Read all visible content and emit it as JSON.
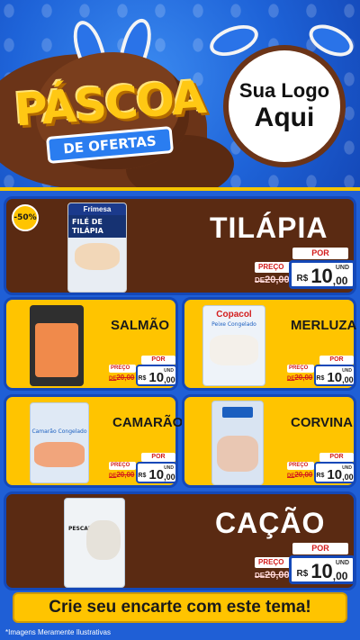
{
  "header": {
    "title": "PÁSCOA",
    "subtitle": "DE OFERTAS",
    "logo_line1": "Sua Logo",
    "logo_line2": "Aqui"
  },
  "badge": "-50%",
  "products": [
    {
      "name": "TILÁPIA",
      "brand": "Frimesa",
      "pack_text": "FILÉ DE TILÁPIA",
      "preco_label": "PREÇO",
      "por_label": "POR",
      "old_prefix": "DE",
      "old_price": "20,00",
      "currency": "R$",
      "new_int": "10",
      "new_dec": ",00",
      "unit": "UND"
    },
    {
      "name": "SALMÃO",
      "brand": "",
      "pack_text": "",
      "preco_label": "PREÇO",
      "por_label": "POR",
      "old_prefix": "DE",
      "old_price": "20,00",
      "currency": "R$",
      "new_int": "10",
      "new_dec": ",00",
      "unit": "UND"
    },
    {
      "name": "MERLUZA",
      "brand": "Copacol",
      "pack_text": "Peixe Congelado",
      "preco_label": "PREÇO",
      "por_label": "POR",
      "old_prefix": "DE",
      "old_price": "20,00",
      "currency": "R$",
      "new_int": "10",
      "new_dec": ",00",
      "unit": "UND"
    },
    {
      "name": "CAMARÃO",
      "brand": "",
      "pack_text": "Camarão Congelado",
      "preco_label": "PREÇO",
      "por_label": "POR",
      "old_prefix": "DE",
      "old_price": "20,00",
      "currency": "R$",
      "new_int": "10",
      "new_dec": ",00",
      "unit": "UND"
    },
    {
      "name": "CORVINA",
      "brand": "",
      "pack_text": "",
      "preco_label": "PREÇO",
      "por_label": "POR",
      "old_prefix": "DE",
      "old_price": "20,00",
      "currency": "R$",
      "new_int": "10",
      "new_dec": ",00",
      "unit": "UND"
    },
    {
      "name": "CAÇÃO",
      "brand": "",
      "pack_text": "PESCADOS",
      "preco_label": "PREÇO",
      "por_label": "POR",
      "old_prefix": "DE",
      "old_price": "20,00",
      "currency": "R$",
      "new_int": "10",
      "new_dec": ",00",
      "unit": "UND"
    }
  ],
  "banner": "Crie seu encarte com este tema!",
  "disclaimer": "*Imagens Meramente Ilustrativas",
  "colors": {
    "background": "#1f5fd6",
    "card_yellow": "#ffc400",
    "card_brown": "#5a2a12",
    "price_red": "#d31c1c",
    "brand_blue": "#1448b8"
  }
}
